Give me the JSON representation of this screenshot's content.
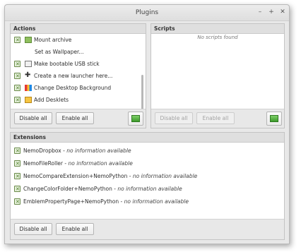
{
  "window": {
    "title": "Plugins",
    "controls": [
      "–",
      "+",
      "✕"
    ]
  },
  "actions": {
    "header": "Actions",
    "items": [
      {
        "label": "Mount archive",
        "checked": true,
        "icon": "folder-icon"
      },
      {
        "label": "Set as Wallpaper...",
        "checked": false,
        "icon": "wallpaper-icon"
      },
      {
        "label": "Make bootable USB stick",
        "checked": true,
        "icon": "usb-icon"
      },
      {
        "label": "Create a new launcher here...",
        "checked": true,
        "icon": "plus-icon"
      },
      {
        "label": "Change Desktop Background",
        "checked": true,
        "icon": "color-bars-icon"
      },
      {
        "label": "Add Desklets",
        "checked": true,
        "icon": "desklet-icon"
      }
    ],
    "disable_all": "Disable all",
    "enable_all": "Enable all"
  },
  "scripts": {
    "header": "Scripts",
    "empty_text": "No scripts found",
    "disable_all": "Disable all",
    "enable_all": "Enable all"
  },
  "extensions": {
    "header": "Extensions",
    "no_info": "no information available",
    "items": [
      {
        "name": "NemoDropbox",
        "sep": " - "
      },
      {
        "name": "NemoFileRoller",
        "sep": " - "
      },
      {
        "name": "NemoCompareExtension+NemoPython",
        "sep": " - "
      },
      {
        "name": "ChangeColorFolder+NemoPython",
        "sep": " - "
      },
      {
        "name": "EmblemPropertyPage+NemoPython",
        "sep": " - "
      }
    ],
    "disable_all": "Disable all",
    "enable_all": "Enable all"
  }
}
